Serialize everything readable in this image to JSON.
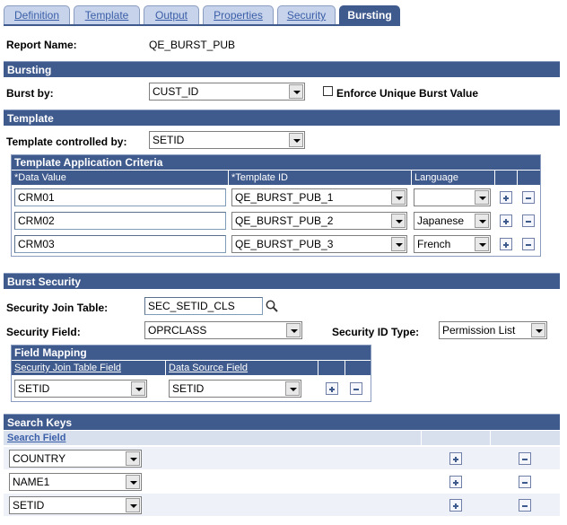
{
  "tabs": [
    {
      "label": "Definition"
    },
    {
      "label": "Template"
    },
    {
      "label": "Output"
    },
    {
      "label": "Properties"
    },
    {
      "label": "Security"
    },
    {
      "label": "Bursting"
    }
  ],
  "report": {
    "label": "Report Name:",
    "value": "QE_BURST_PUB"
  },
  "bursting": {
    "section_title": "Bursting",
    "burst_by_label": "Burst by:",
    "burst_by_value": "CUST_ID",
    "enforce_label": "Enforce Unique Burst Value"
  },
  "template": {
    "section_title": "Template",
    "controlled_label": "Template controlled by:",
    "controlled_value": "SETID",
    "grid_title": "Template Application Criteria",
    "columns": [
      "*Data Value",
      "*Template ID",
      "Language"
    ],
    "rows": [
      {
        "data_value": "CRM01",
        "template_id": "QE_BURST_PUB_1",
        "language": ""
      },
      {
        "data_value": "CRM02",
        "template_id": "QE_BURST_PUB_2",
        "language": "Japanese"
      },
      {
        "data_value": "CRM03",
        "template_id": "QE_BURST_PUB_3",
        "language": "French"
      }
    ]
  },
  "burst_security": {
    "section_title": "Burst Security",
    "join_table_label": "Security Join Table:",
    "join_table_value": "SEC_SETID_CLS",
    "field_label": "Security Field:",
    "field_value": "OPRCLASS",
    "id_type_label": "Security ID Type:",
    "id_type_value": "Permission List",
    "mapping_title": "Field Mapping",
    "mapping_columns": [
      "Security Join Table Field",
      "Data Source Field"
    ],
    "mapping_row": {
      "join_field": "SETID",
      "data_source_field": "SETID"
    }
  },
  "search_keys": {
    "section_title": "Search Keys",
    "column": "Search Field",
    "rows": [
      {
        "value": "COUNTRY"
      },
      {
        "value": "NAME1"
      },
      {
        "value": "SETID"
      }
    ]
  },
  "colors": {
    "header": "#3f5a8d",
    "tab_inactive": "#c7d3ea",
    "link": "#3a5ea8"
  }
}
